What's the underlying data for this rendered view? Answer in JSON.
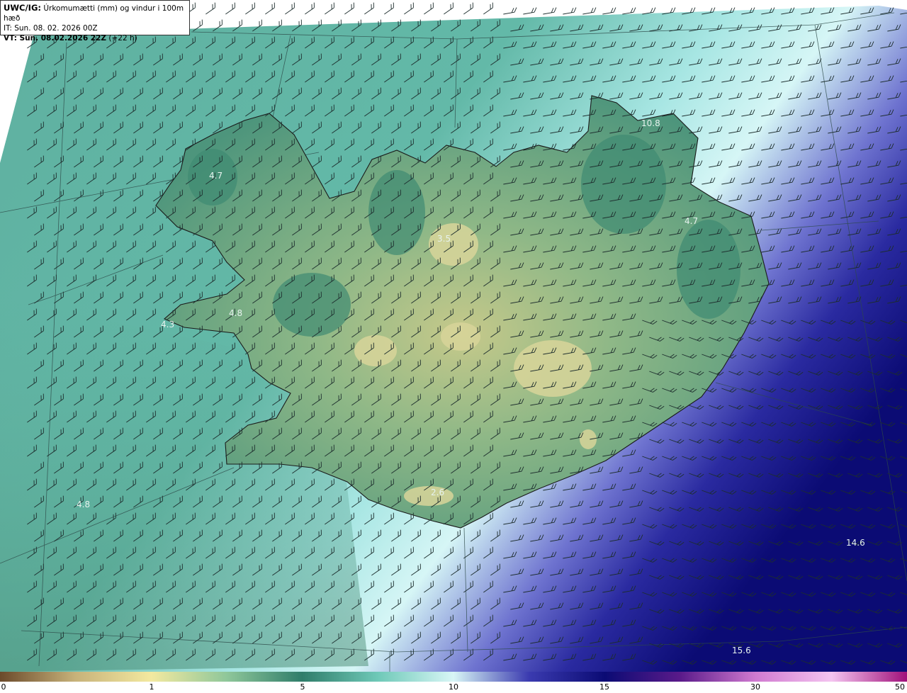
{
  "header": {
    "product": "UWC/IG:",
    "description": "Úrkomumætti (mm) og vindur i 100m hæð",
    "initial_time": "IT: Sun. 08. 02. 2026 00Z",
    "valid_label": "VT: Sun. 08.02.2026 22Z",
    "lead_time": "(+22 h)"
  },
  "map": {
    "value_labels": [
      "4.7",
      "10.8",
      "4.7",
      "3.5",
      "4.8",
      "4.3",
      "4.8",
      "2.6",
      "14.6",
      "15.6"
    ],
    "field_colors": {
      "land_low": "#8fbf8f",
      "land_mid": "#4f9a7e",
      "sea": "#5fb8a8",
      "moist_high": "#b8eeee",
      "very_high": "#23239a",
      "extreme": "#0b0b74"
    }
  },
  "colorbar": {
    "ticks": [
      "0",
      "1",
      "5",
      "10",
      "15",
      "30",
      "50"
    ],
    "colors": [
      "#6b4a2b",
      "#c7b27a",
      "#f3e9a0",
      "#8fc79a",
      "#2f7d6a",
      "#6fc9b8",
      "#d8f6f6",
      "#3b3bb0",
      "#0b0b74",
      "#5a1a8a",
      "#d07ad0",
      "#f4c4f0",
      "#a0107a"
    ]
  }
}
